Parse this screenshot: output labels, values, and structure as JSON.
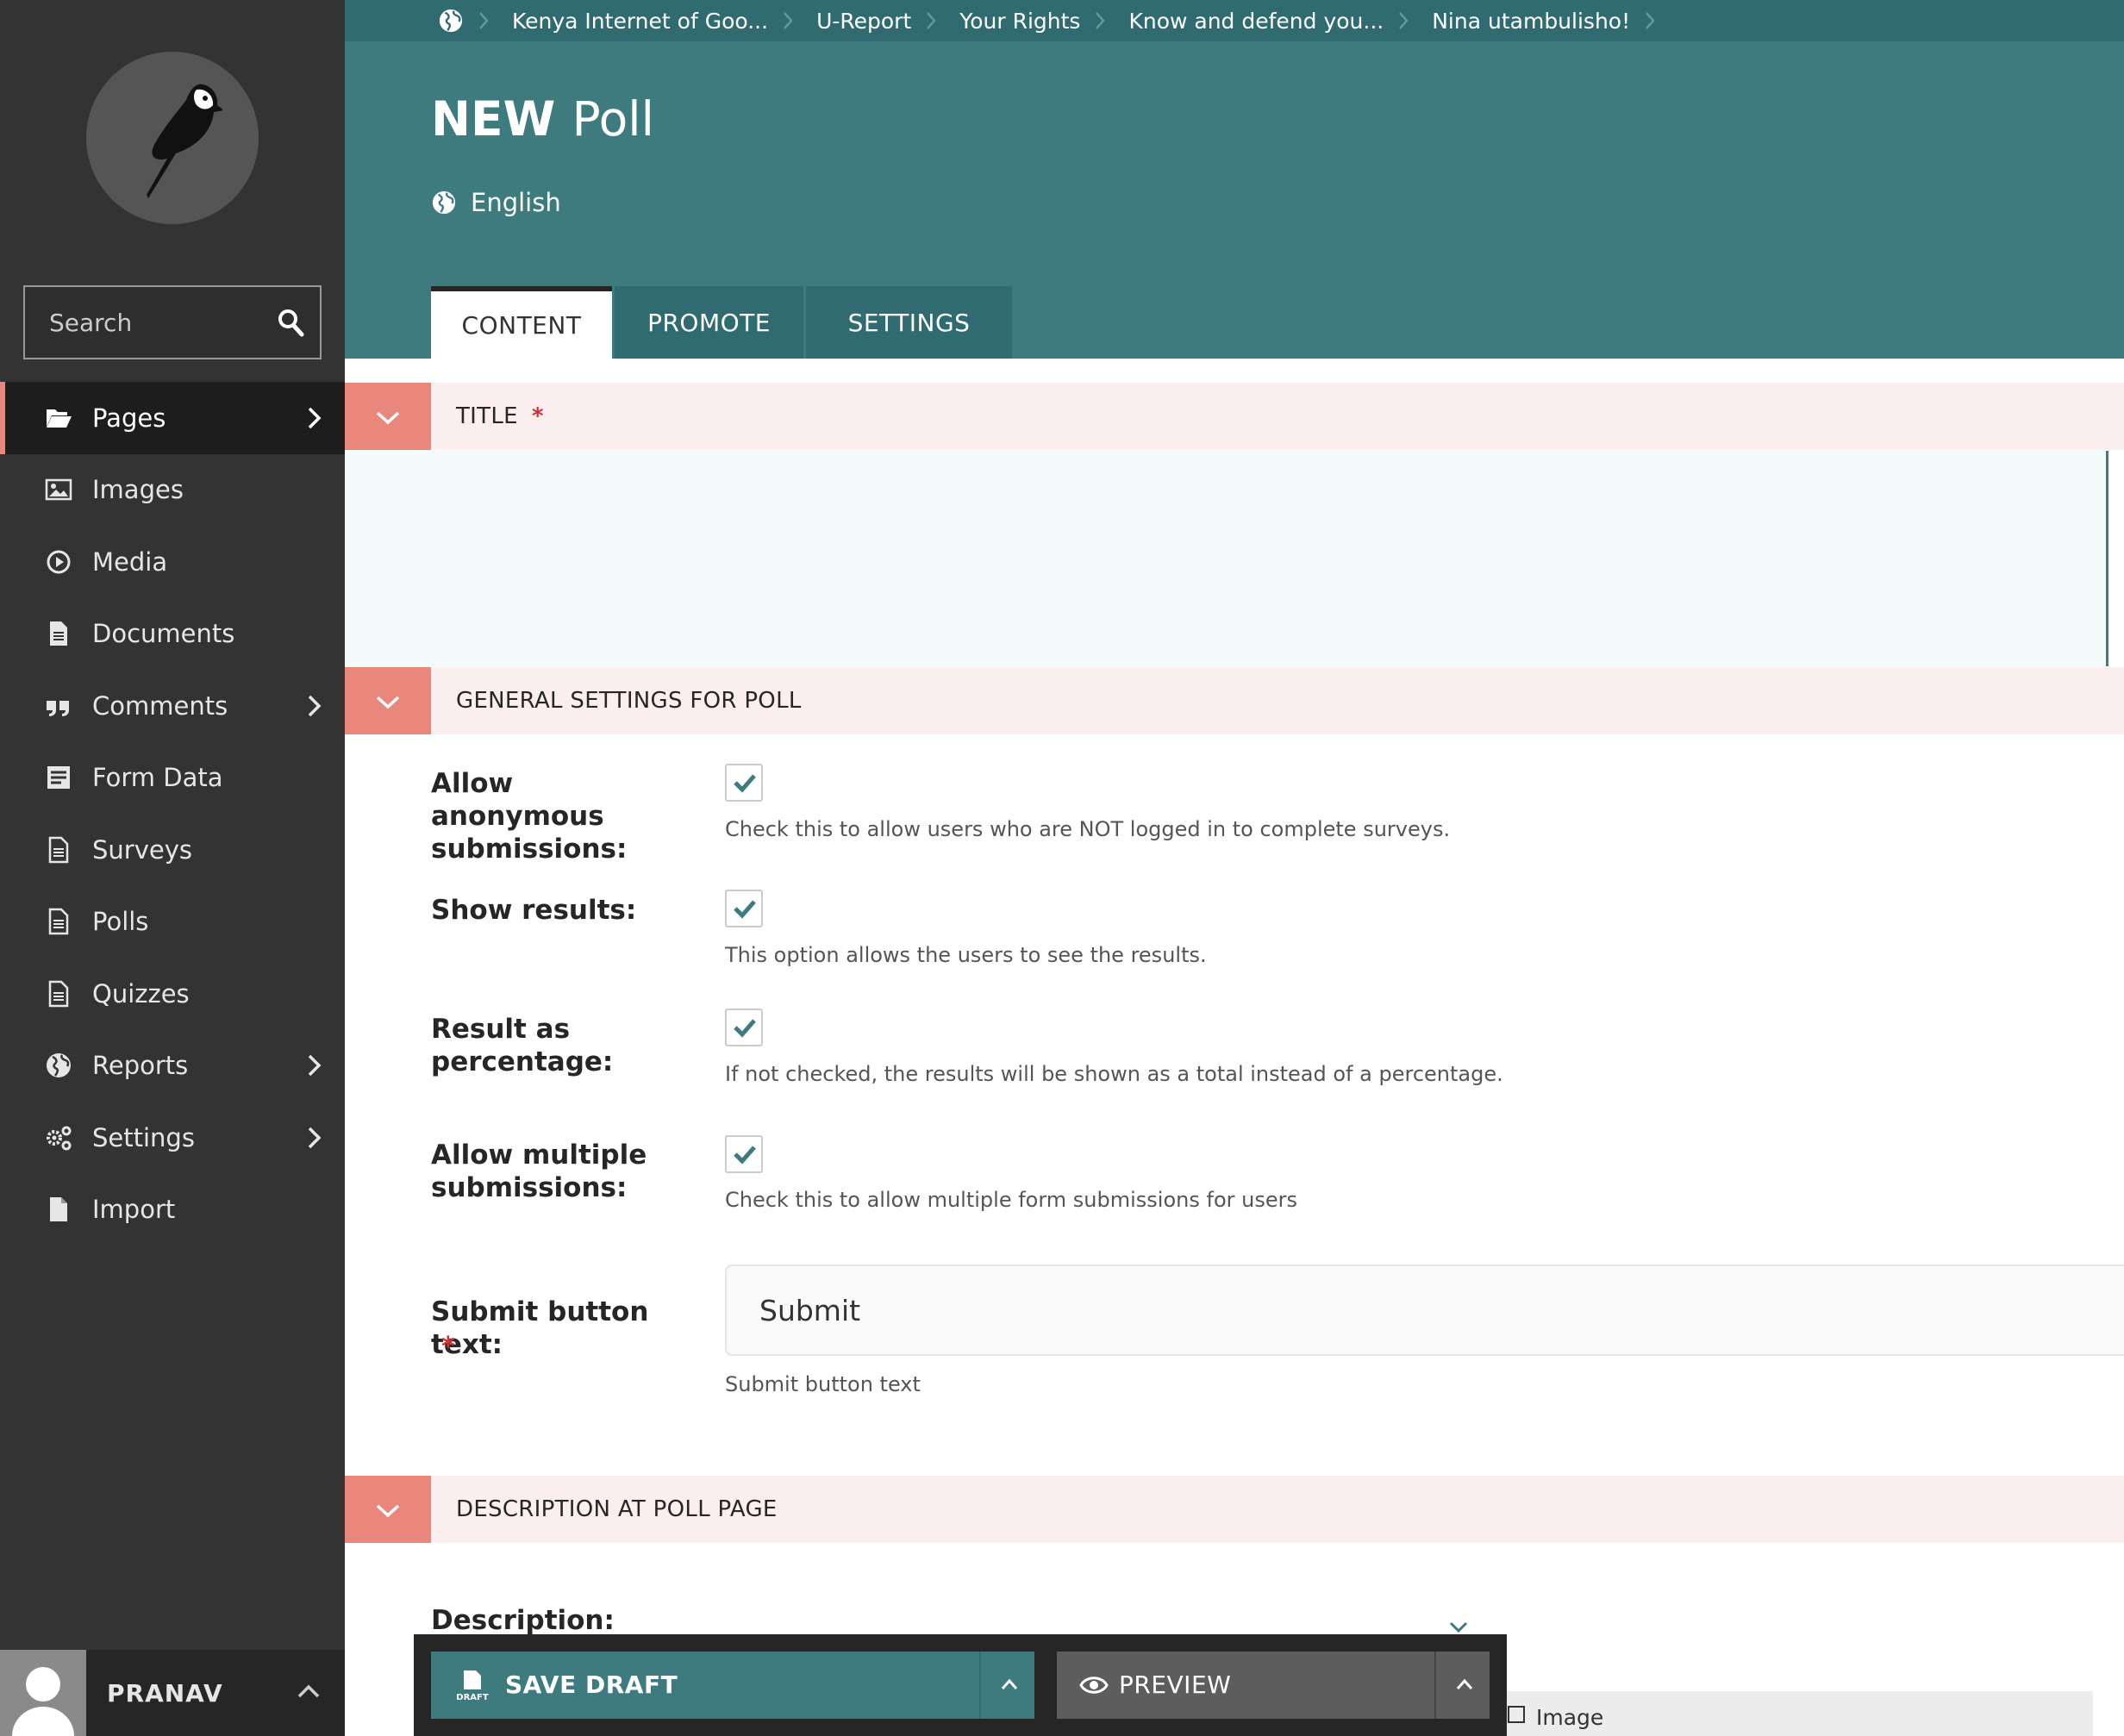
{
  "sidebar": {
    "search": {
      "placeholder": "Search"
    },
    "items": [
      {
        "label": "Pages",
        "icon": "folder-open-icon",
        "has_submenu": true,
        "active": true
      },
      {
        "label": "Images",
        "icon": "image-icon",
        "has_submenu": false
      },
      {
        "label": "Media",
        "icon": "media-play-icon",
        "has_submenu": false
      },
      {
        "label": "Documents",
        "icon": "document-icon",
        "has_submenu": false
      },
      {
        "label": "Comments",
        "icon": "quote-icon",
        "has_submenu": true
      },
      {
        "label": "Form Data",
        "icon": "form-icon",
        "has_submenu": false
      },
      {
        "label": "Surveys",
        "icon": "doc-outline-icon",
        "has_submenu": false
      },
      {
        "label": "Polls",
        "icon": "doc-outline-icon",
        "has_submenu": false
      },
      {
        "label": "Quizzes",
        "icon": "doc-outline-icon",
        "has_submenu": false
      },
      {
        "label": "Reports",
        "icon": "globe-icon",
        "has_submenu": true
      },
      {
        "label": "Settings",
        "icon": "cogs-icon",
        "has_submenu": true
      },
      {
        "label": "Import",
        "icon": "file-icon",
        "has_submenu": false
      }
    ],
    "account": {
      "name": "PRANAV"
    }
  },
  "breadcrumb": [
    "Kenya Internet of Goo...",
    "U-Report",
    "Your Rights",
    "Know and defend you...",
    "Nina utambulisho!"
  ],
  "header": {
    "title_bold": "NEW",
    "title_light": "Poll",
    "locale": "English"
  },
  "tabs": [
    {
      "label": "CONTENT",
      "active": true
    },
    {
      "label": "PROMOTE",
      "active": false
    },
    {
      "label": "SETTINGS",
      "active": false
    }
  ],
  "panels": {
    "title": {
      "label": "TITLE",
      "required": "*",
      "value": ""
    },
    "general": {
      "label": "GENERAL SETTINGS FOR POLL"
    },
    "description": {
      "label": "DESCRIPTION AT POLL PAGE"
    }
  },
  "fields": {
    "anonymous": {
      "label": "Allow anonymous submissions:",
      "checked": true,
      "help": "Check this to allow users who are NOT logged in to complete surveys."
    },
    "show_results": {
      "label": "Show results:",
      "checked": true,
      "help": "This option allows the users to see the results."
    },
    "percentage": {
      "label": "Result as percentage:",
      "checked": true,
      "help": "If not checked, the results will be shown as a total instead of a percentage."
    },
    "multiple": {
      "label": "Allow multiple submissions:",
      "checked": true,
      "help": "Check this to allow multiple form submissions for users"
    },
    "submit_text": {
      "label": "Submit button text:",
      "required": "*",
      "value": "Submit",
      "help": "Submit button text"
    },
    "description": {
      "label": "Description:"
    }
  },
  "actions": {
    "save_draft": "SAVE DRAFT",
    "preview": "PREVIEW",
    "draft_icon_text": "DRAFT"
  },
  "rich_text": {
    "image_button": "Image"
  },
  "colors": {
    "sidebar_bg": "#333333",
    "header_teal": "#3d7b7f",
    "accent_salmon": "#e9877c",
    "panel_head_bg": "#fbeeee",
    "required_red": "#cd3238"
  }
}
